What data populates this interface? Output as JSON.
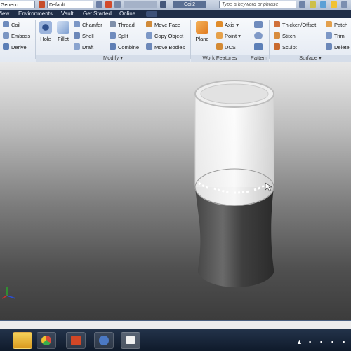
{
  "quick_access": {
    "material_combo": "Generic",
    "appearance_combo": "Default",
    "document_title": "Coil2",
    "search_placeholder": "Type a keyword or phrase"
  },
  "menu_tabs": [
    "View",
    "Environments",
    "Vault",
    "Get Started",
    "Online"
  ],
  "ribbon": {
    "create_small": [
      "Coil",
      "Emboss",
      "Derive"
    ],
    "modify": {
      "big": [
        "Hole",
        "Fillet"
      ],
      "col1": [
        "Chamfer",
        "Shell",
        "Draft"
      ],
      "col2": [
        "Thread",
        "Split",
        "Combine"
      ],
      "col3": [
        "Move Face",
        "Copy Object",
        "Move Bodies"
      ],
      "title": "Modify ▾"
    },
    "work_features": {
      "big": "Plane",
      "small": [
        "Axis ▾",
        "Point ▾",
        "UCS"
      ],
      "title": "Work Features"
    },
    "pattern": {
      "title": "Pattern"
    },
    "surface": {
      "col1": [
        "Thicken/Offset",
        "Stitch",
        "Sculpt"
      ],
      "col2": [
        "Patch",
        "Trim",
        "Delete"
      ],
      "title": "Surface ▾"
    }
  },
  "viewport": {
    "model_description_text": "",
    "triad_labels": {
      "x": "X",
      "y": "Y",
      "z": "Z"
    }
  },
  "taskbar": {
    "apps": [
      "inventor-icon",
      "chrome-icon",
      "powerpoint-icon",
      "media-icon",
      "folder-icon"
    ]
  }
}
